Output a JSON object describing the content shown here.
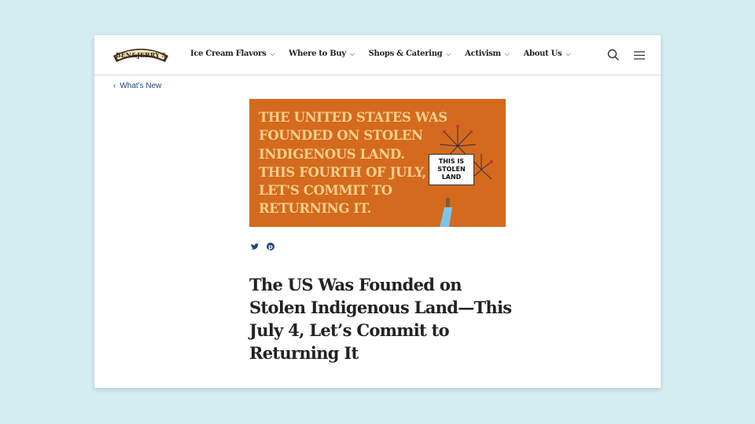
{
  "header": {
    "logo": "BEN&JERRY'S",
    "nav": [
      {
        "label": "Ice Cream Flavors"
      },
      {
        "label": "Where to Buy"
      },
      {
        "label": "Shops & Catering"
      },
      {
        "label": "Activism"
      },
      {
        "label": "About Us"
      }
    ],
    "icons": [
      "search-icon",
      "menu-icon"
    ]
  },
  "breadcrumb": {
    "label": "What's New"
  },
  "banner": {
    "text": "THE UNITED STATES WAS\nFOUNDED ON STOLEN\nINDIGENOUS LAND.\nTHIS FOURTH OF JULY,\nLET'S COMMIT TO\nRETURNING IT.",
    "sign": "THIS IS STOLEN LAND"
  },
  "share": [
    "twitter-icon",
    "pinterest-icon"
  ],
  "article": {
    "title": "The US Was Founded on Stolen Indigenous Land—This July 4, Let’s Commit to Returning It"
  },
  "colors": {
    "background": "#d4edf1",
    "banner": "#d46a1e",
    "banner_text": "#fbd08c",
    "link": "#24447a"
  }
}
